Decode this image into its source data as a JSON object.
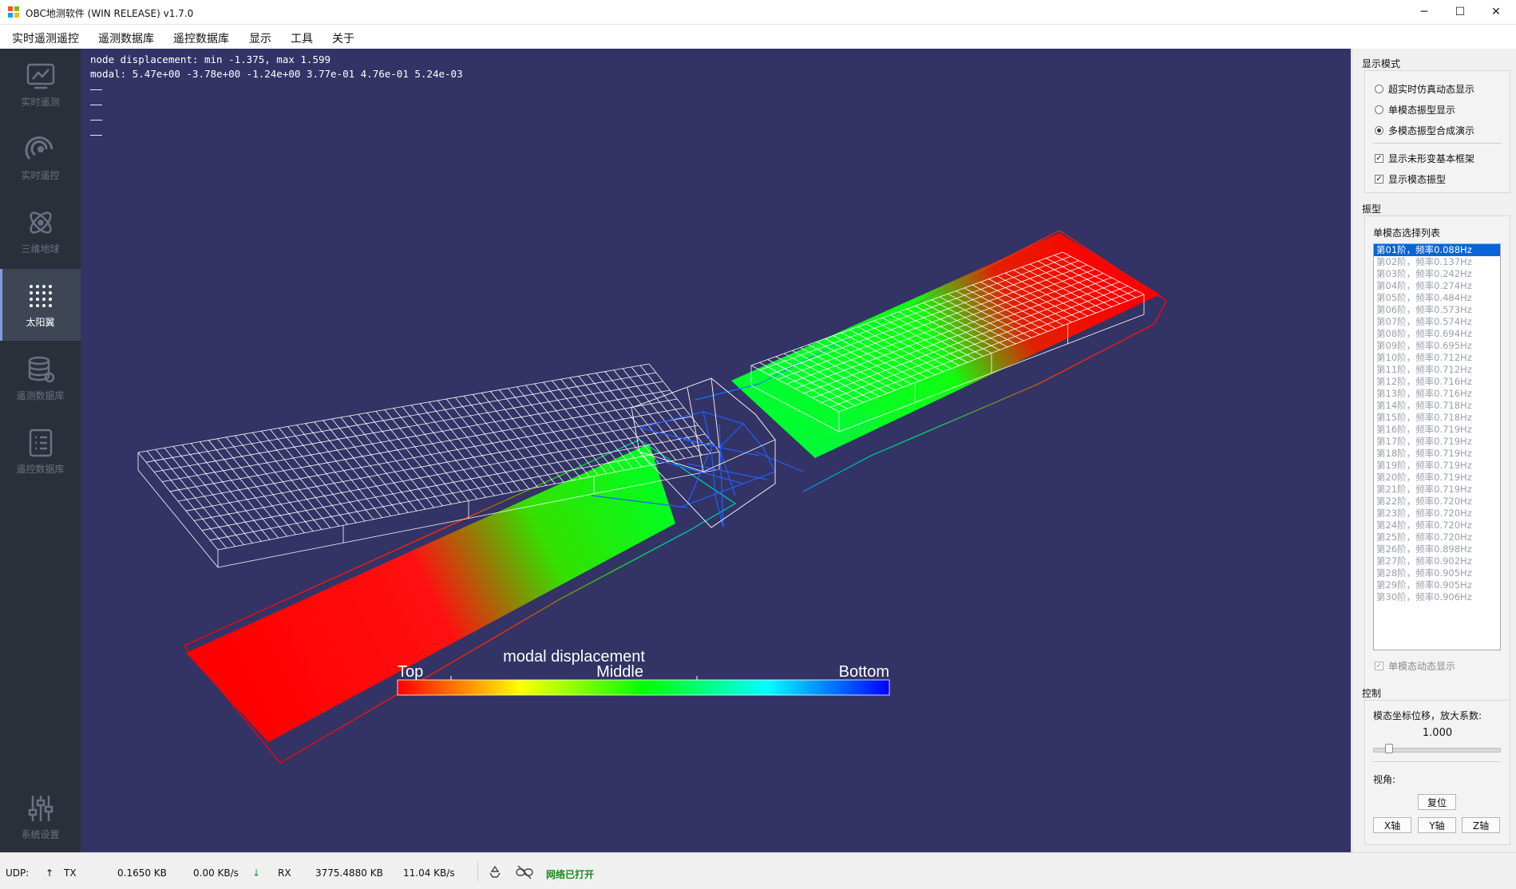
{
  "window": {
    "title": "OBC地测软件 (WIN RELEASE) v1.7.0",
    "minimize": "─",
    "maximize": "☐",
    "close": "✕"
  },
  "menu": [
    "实时遥测遥控",
    "遥测数据库",
    "遥控数据库",
    "显示",
    "工具",
    "关于"
  ],
  "sidebar": {
    "items": [
      {
        "label": "实时遥测",
        "icon": "telemetry-chart-icon"
      },
      {
        "label": "实时遥控",
        "icon": "remote-control-icon"
      },
      {
        "label": "三维地球",
        "icon": "atom-globe-icon"
      },
      {
        "label": "太阳翼",
        "icon": "solar-wing-grid-icon",
        "active": true
      },
      {
        "label": "遥测数据库",
        "icon": "database-icon"
      },
      {
        "label": "遥控数据库",
        "icon": "list-document-icon"
      }
    ],
    "settings_label": "系统设置"
  },
  "viewport": {
    "info_lines": [
      "node displacement: min -1.375, max 1.599",
      "modal: 5.47e+00 -3.78e+00 -1.24e+00 3.77e-01 4.76e-01 5.24e-03",
      "——",
      "——",
      "——",
      "——"
    ],
    "legend": {
      "title": "modal displacement",
      "top": "Top",
      "middle": "Middle",
      "bottom": "Bottom"
    },
    "colors": {
      "background": "#333366",
      "top": "#ff0000",
      "middle": "#00ff00",
      "bottom": "#0000ff"
    }
  },
  "panel": {
    "display_mode": {
      "title": "显示模式",
      "radios": [
        {
          "label": "超实时仿真动态显示",
          "checked": false
        },
        {
          "label": "单模态振型显示",
          "checked": false
        },
        {
          "label": "多模态振型合成演示",
          "checked": true
        }
      ],
      "checks": [
        {
          "label": "显示未形变基本框架",
          "checked": true
        },
        {
          "label": "显示模态振型",
          "checked": true
        }
      ]
    },
    "mode_shape": {
      "title": "振型",
      "list_title": "单模态选择列表",
      "items": [
        "第01阶，频率0.088Hz",
        "第02阶，频率0.137Hz",
        "第03阶，频率0.242Hz",
        "第04阶，频率0.274Hz",
        "第05阶，频率0.484Hz",
        "第06阶，频率0.573Hz",
        "第07阶，频率0.574Hz",
        "第08阶，频率0.694Hz",
        "第09阶，频率0.695Hz",
        "第10阶，频率0.712Hz",
        "第11阶，频率0.712Hz",
        "第12阶，频率0.716Hz",
        "第13阶，频率0.716Hz",
        "第14阶，频率0.718Hz",
        "第15阶，频率0.718Hz",
        "第16阶，频率0.719Hz",
        "第17阶，频率0.719Hz",
        "第18阶，频率0.719Hz",
        "第19阶，频率0.719Hz",
        "第20阶，频率0.719Hz",
        "第21阶，频率0.719Hz",
        "第22阶，频率0.720Hz",
        "第23阶，频率0.720Hz",
        "第24阶，频率0.720Hz",
        "第25阶，频率0.720Hz",
        "第26阶，频率0.898Hz",
        "第27阶，频率0.902Hz",
        "第28阶，频率0.905Hz",
        "第29阶，频率0.905Hz",
        "第30阶，频率0.906Hz"
      ],
      "selected_index": 0,
      "single_dynamic_label": "单模态动态显示"
    },
    "control": {
      "title": "控制",
      "scale_label": "模态坐标位移，放大系数:",
      "scale_value": "1.000",
      "slider_fraction": 0.1,
      "view_label": "视角:",
      "reset_button": "复位",
      "axis_buttons": [
        "X轴",
        "Y轴",
        "Z轴"
      ]
    }
  },
  "status": {
    "udp": "UDP:",
    "tx_arrow": "↑",
    "tx": "TX",
    "tx_size": "0.1650 KB",
    "tx_rate": "0.00 KB/s",
    "rx_arrow": "↓",
    "rx": "RX",
    "rx_size": "3775.4880 KB",
    "rx_rate": "11.04 KB/s",
    "network": "网络已打开"
  }
}
